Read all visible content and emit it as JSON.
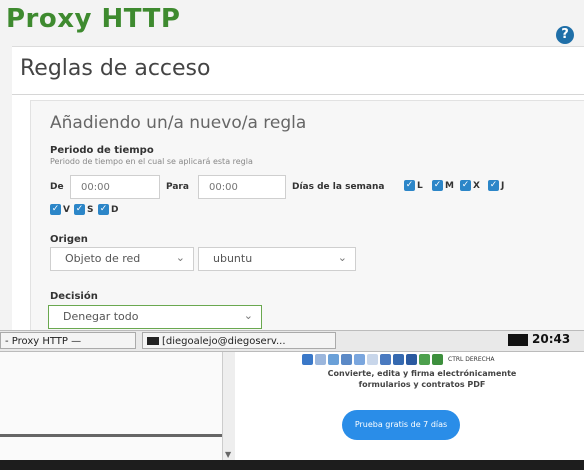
{
  "header": {
    "title": "Proxy HTTP",
    "help_icon": "help-icon"
  },
  "section": {
    "title": "Reglas de acceso"
  },
  "form": {
    "title": "Añadiendo un/a nuevo/a regla",
    "period": {
      "label": "Periodo de tiempo",
      "help": "Periodo de tiempo en el cual se aplicará esta regla",
      "from_label": "De",
      "from_placeholder": "00:00",
      "to_label": "Para",
      "to_placeholder": "00:00",
      "days_label": "Días de la semana",
      "days": [
        {
          "label": "L",
          "checked": true
        },
        {
          "label": "M",
          "checked": true
        },
        {
          "label": "X",
          "checked": true
        },
        {
          "label": "J",
          "checked": true
        },
        {
          "label": "V",
          "checked": true
        },
        {
          "label": "S",
          "checked": true
        },
        {
          "label": "D",
          "checked": true
        }
      ]
    },
    "origin": {
      "label": "Origen",
      "type_value": "Objeto de red",
      "object_value": "ubuntu"
    },
    "decision": {
      "label": "Decisión",
      "value": "Denegar todo"
    }
  },
  "taskbar": {
    "items": [
      {
        "label": "- Proxy HTTP —"
      },
      {
        "label": "[diegoalejo@diegoserv..."
      }
    ],
    "clock": "20:43",
    "ctrl_label": "CTRL DERECHA"
  },
  "promo": {
    "line1": "Convierte, edita y firma electrónicamente",
    "line2": "formularios y contratos PDF",
    "button": "Prueba gratis de 7 días"
  },
  "colors": {
    "accent_green": "#3e8a2f",
    "checkbox_blue": "#2c86c8",
    "promo_blue": "#2a8de8"
  }
}
